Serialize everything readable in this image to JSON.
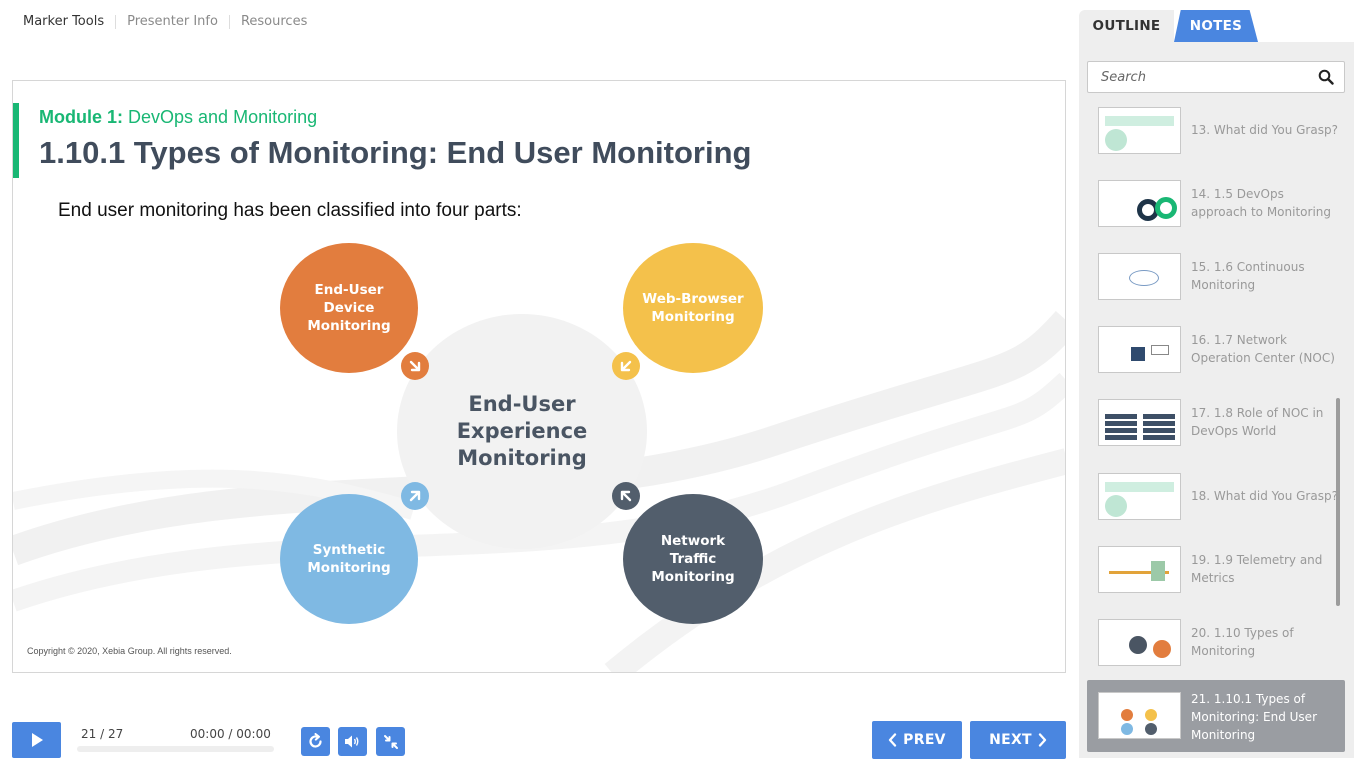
{
  "top_menu": {
    "items": [
      "Marker Tools",
      "Presenter Info",
      "Resources"
    ]
  },
  "slide": {
    "module_label": "Module 1:",
    "module_name": "DevOps and Monitoring",
    "title": "1.10.1 Types of Monitoring: End User Monitoring",
    "intro": "End user monitoring has been classified into four parts:",
    "center_text": "End-User Experience Monitoring",
    "parts": [
      {
        "text": "End-User Device Monitoring",
        "color": "#e27d3e"
      },
      {
        "text": "Web-Browser Monitoring",
        "color": "#f4c14b"
      },
      {
        "text": "Synthetic Monitoring",
        "color": "#7fb9e3"
      },
      {
        "text": "Network Traffic Monitoring",
        "color": "#525e6c"
      }
    ],
    "copyright": "Copyright © 2020, Xebia Group. All rights reserved."
  },
  "sidebar": {
    "tabs": {
      "outline": "OUTLINE",
      "notes": "NOTES"
    },
    "search_placeholder": "Search",
    "items": [
      {
        "label": "13. What did You Grasp?",
        "active": false
      },
      {
        "label": "14. 1.5 DevOps approach to Monitoring",
        "active": false
      },
      {
        "label": "15. 1.6 Continuous Monitoring",
        "active": false
      },
      {
        "label": "16. 1.7 Network Operation Center (NOC)",
        "active": false
      },
      {
        "label": "17. 1.8 Role of NOC in DevOps World",
        "active": false
      },
      {
        "label": "18. What did You Grasp?",
        "active": false
      },
      {
        "label": "19. 1.9 Telemetry and Metrics",
        "active": false
      },
      {
        "label": "20. 1.10 Types of Monitoring",
        "active": false
      },
      {
        "label": "21. 1.10.1 Types of Monitoring: End User Monitoring",
        "active": true
      }
    ]
  },
  "player": {
    "slide_counter": "21 / 27",
    "time": "00:00 / 00:00",
    "progress": 0,
    "prev_label": "PREV",
    "next_label": "NEXT"
  },
  "colors": {
    "accent": "#4a86e0",
    "brand_green": "#19b774",
    "active_item": "#9a9da2"
  }
}
